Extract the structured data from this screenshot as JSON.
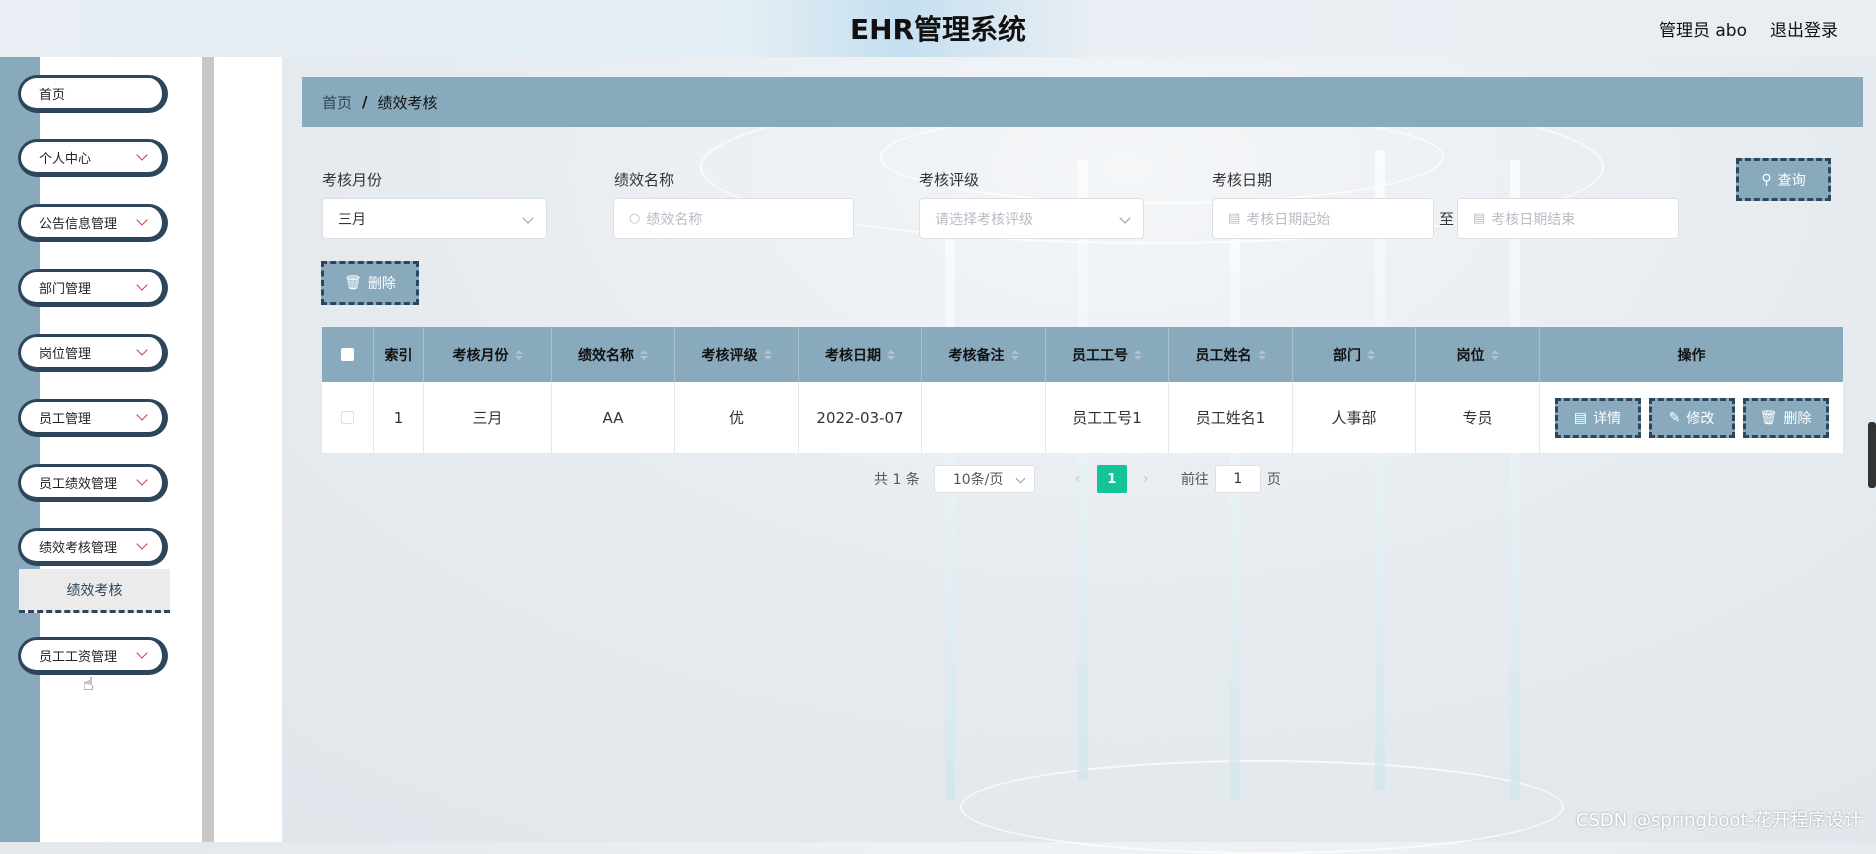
{
  "header": {
    "title": "EHR管理系统",
    "user": "管理员 abo",
    "logout": "退出登录"
  },
  "sidebar": {
    "items": [
      {
        "label": "首页"
      },
      {
        "label": "个人中心"
      },
      {
        "label": "公告信息管理"
      },
      {
        "label": "部门管理"
      },
      {
        "label": "岗位管理"
      },
      {
        "label": "员工管理"
      },
      {
        "label": "员工绩效管理"
      },
      {
        "label": "绩效考核管理"
      },
      {
        "label": "员工工资管理"
      }
    ],
    "submenu_active": "绩效考核"
  },
  "breadcrumb": {
    "home": "首页",
    "separator": "/",
    "current": "绩效考核"
  },
  "search": {
    "month_label": "考核月份",
    "month_value": "三月",
    "name_label": "绩效名称",
    "name_placeholder": "绩效名称",
    "grade_label": "考核评级",
    "grade_placeholder": "请选择考核评级",
    "date_label": "考核日期",
    "date_start_placeholder": "考核日期起始",
    "date_sep": "至",
    "date_end_placeholder": "考核日期结束",
    "query_button": "查询"
  },
  "actions": {
    "delete_button": "删除"
  },
  "table": {
    "columns": [
      "索引",
      "考核月份",
      "绩效名称",
      "考核评级",
      "考核日期",
      "考核备注",
      "员工工号",
      "员工姓名",
      "部门",
      "岗位",
      "操作"
    ],
    "rows": [
      {
        "index": "1",
        "month": "三月",
        "name": "AA",
        "grade": "优",
        "date": "2022-03-07",
        "remark": "",
        "emp_no": "员工工号1",
        "emp_name": "员工姓名1",
        "dept": "人事部",
        "post": "专员"
      }
    ],
    "row_actions": {
      "detail": "详情",
      "edit": "修改",
      "delete": "删除"
    }
  },
  "pagination": {
    "total": "共 1 条",
    "page_size": "10条/页",
    "prev": "‹",
    "current_page": "1",
    "next": "›",
    "goto_label": "前往",
    "goto_value": "1",
    "page_unit": "页"
  },
  "watermark": "CSDN @springboot-花开程序设计",
  "colors": {
    "accent": "#89a9bd",
    "dark": "#2e465b",
    "page_active": "#12c49a"
  }
}
